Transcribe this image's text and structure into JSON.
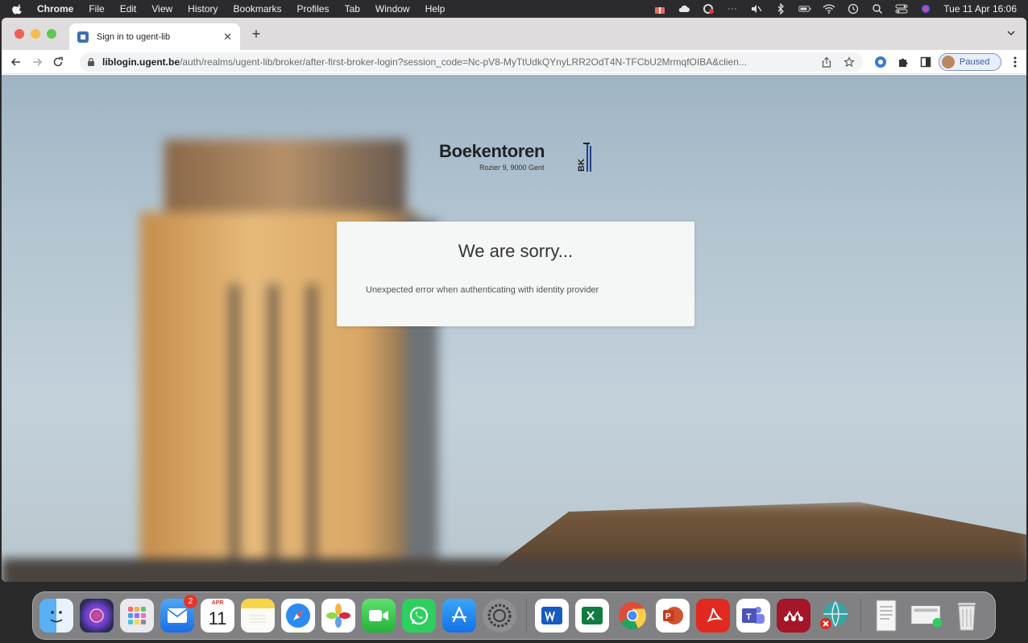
{
  "menubar": {
    "app_name": "Chrome",
    "items": [
      "File",
      "Edit",
      "View",
      "History",
      "Bookmarks",
      "Profiles",
      "Tab",
      "Window",
      "Help"
    ],
    "clock": "Tue 11 Apr  16:06"
  },
  "browser": {
    "tab": {
      "title": "Sign in to ugent-lib",
      "close_glyph": "✕"
    },
    "new_tab_glyph": "+",
    "url_host": "liblogin.ugent.be",
    "url_path": "/auth/realms/ugent-lib/broker/after-first-broker-login?session_code=Nc-pV8-MyTtUdkQYnyLRR2OdT4N-TFCbU2MrmqfOIBA&clien...",
    "profile_label": "Paused"
  },
  "page": {
    "brand_name": "Boekentoren",
    "brand_address": "Rozier 9, 9000 Gent",
    "brand_mark_letters": "BK",
    "error_title": "We are sorry...",
    "error_message": "Unexpected error when authenticating with identity provider"
  },
  "dock": {
    "mail_badge": "2",
    "calendar_month": "APR",
    "calendar_day": "11"
  },
  "colors": {
    "menubar_bg": "#2b2b2d",
    "tabbar_bg": "#dedcdc",
    "profile_accent": "#3c5ea6",
    "card_bg": "#f5f6f6",
    "sky": "#b3c5d1"
  }
}
